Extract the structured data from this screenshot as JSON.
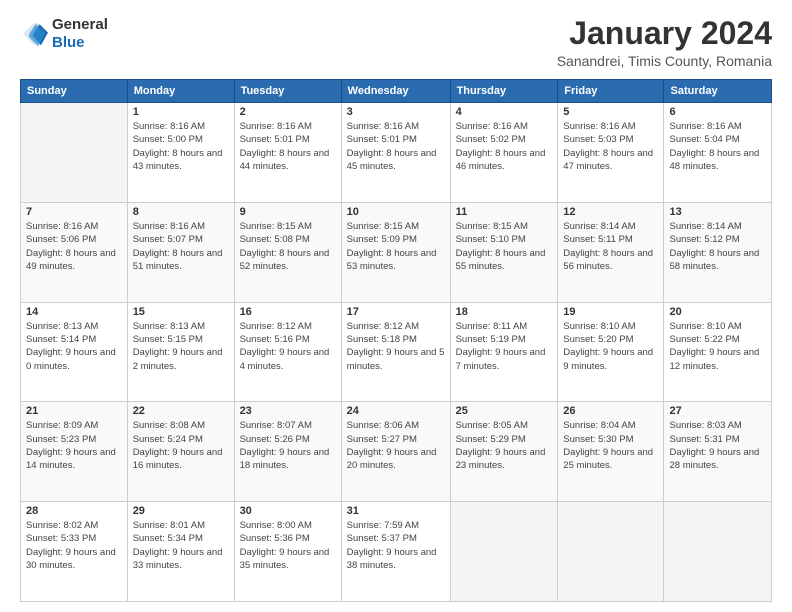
{
  "logo": {
    "general": "General",
    "blue": "Blue"
  },
  "title": {
    "month_year": "January 2024",
    "location": "Sanandrei, Timis County, Romania"
  },
  "weekdays": [
    "Sunday",
    "Monday",
    "Tuesday",
    "Wednesday",
    "Thursday",
    "Friday",
    "Saturday"
  ],
  "weeks": [
    [
      {
        "day": "",
        "sunrise": "",
        "sunset": "",
        "daylight": ""
      },
      {
        "day": "1",
        "sunrise": "Sunrise: 8:16 AM",
        "sunset": "Sunset: 5:00 PM",
        "daylight": "Daylight: 8 hours and 43 minutes."
      },
      {
        "day": "2",
        "sunrise": "Sunrise: 8:16 AM",
        "sunset": "Sunset: 5:01 PM",
        "daylight": "Daylight: 8 hours and 44 minutes."
      },
      {
        "day": "3",
        "sunrise": "Sunrise: 8:16 AM",
        "sunset": "Sunset: 5:01 PM",
        "daylight": "Daylight: 8 hours and 45 minutes."
      },
      {
        "day": "4",
        "sunrise": "Sunrise: 8:16 AM",
        "sunset": "Sunset: 5:02 PM",
        "daylight": "Daylight: 8 hours and 46 minutes."
      },
      {
        "day": "5",
        "sunrise": "Sunrise: 8:16 AM",
        "sunset": "Sunset: 5:03 PM",
        "daylight": "Daylight: 8 hours and 47 minutes."
      },
      {
        "day": "6",
        "sunrise": "Sunrise: 8:16 AM",
        "sunset": "Sunset: 5:04 PM",
        "daylight": "Daylight: 8 hours and 48 minutes."
      }
    ],
    [
      {
        "day": "7",
        "sunrise": "Sunrise: 8:16 AM",
        "sunset": "Sunset: 5:06 PM",
        "daylight": "Daylight: 8 hours and 49 minutes."
      },
      {
        "day": "8",
        "sunrise": "Sunrise: 8:16 AM",
        "sunset": "Sunset: 5:07 PM",
        "daylight": "Daylight: 8 hours and 51 minutes."
      },
      {
        "day": "9",
        "sunrise": "Sunrise: 8:15 AM",
        "sunset": "Sunset: 5:08 PM",
        "daylight": "Daylight: 8 hours and 52 minutes."
      },
      {
        "day": "10",
        "sunrise": "Sunrise: 8:15 AM",
        "sunset": "Sunset: 5:09 PM",
        "daylight": "Daylight: 8 hours and 53 minutes."
      },
      {
        "day": "11",
        "sunrise": "Sunrise: 8:15 AM",
        "sunset": "Sunset: 5:10 PM",
        "daylight": "Daylight: 8 hours and 55 minutes."
      },
      {
        "day": "12",
        "sunrise": "Sunrise: 8:14 AM",
        "sunset": "Sunset: 5:11 PM",
        "daylight": "Daylight: 8 hours and 56 minutes."
      },
      {
        "day": "13",
        "sunrise": "Sunrise: 8:14 AM",
        "sunset": "Sunset: 5:12 PM",
        "daylight": "Daylight: 8 hours and 58 minutes."
      }
    ],
    [
      {
        "day": "14",
        "sunrise": "Sunrise: 8:13 AM",
        "sunset": "Sunset: 5:14 PM",
        "daylight": "Daylight: 9 hours and 0 minutes."
      },
      {
        "day": "15",
        "sunrise": "Sunrise: 8:13 AM",
        "sunset": "Sunset: 5:15 PM",
        "daylight": "Daylight: 9 hours and 2 minutes."
      },
      {
        "day": "16",
        "sunrise": "Sunrise: 8:12 AM",
        "sunset": "Sunset: 5:16 PM",
        "daylight": "Daylight: 9 hours and 4 minutes."
      },
      {
        "day": "17",
        "sunrise": "Sunrise: 8:12 AM",
        "sunset": "Sunset: 5:18 PM",
        "daylight": "Daylight: 9 hours and 5 minutes."
      },
      {
        "day": "18",
        "sunrise": "Sunrise: 8:11 AM",
        "sunset": "Sunset: 5:19 PM",
        "daylight": "Daylight: 9 hours and 7 minutes."
      },
      {
        "day": "19",
        "sunrise": "Sunrise: 8:10 AM",
        "sunset": "Sunset: 5:20 PM",
        "daylight": "Daylight: 9 hours and 9 minutes."
      },
      {
        "day": "20",
        "sunrise": "Sunrise: 8:10 AM",
        "sunset": "Sunset: 5:22 PM",
        "daylight": "Daylight: 9 hours and 12 minutes."
      }
    ],
    [
      {
        "day": "21",
        "sunrise": "Sunrise: 8:09 AM",
        "sunset": "Sunset: 5:23 PM",
        "daylight": "Daylight: 9 hours and 14 minutes."
      },
      {
        "day": "22",
        "sunrise": "Sunrise: 8:08 AM",
        "sunset": "Sunset: 5:24 PM",
        "daylight": "Daylight: 9 hours and 16 minutes."
      },
      {
        "day": "23",
        "sunrise": "Sunrise: 8:07 AM",
        "sunset": "Sunset: 5:26 PM",
        "daylight": "Daylight: 9 hours and 18 minutes."
      },
      {
        "day": "24",
        "sunrise": "Sunrise: 8:06 AM",
        "sunset": "Sunset: 5:27 PM",
        "daylight": "Daylight: 9 hours and 20 minutes."
      },
      {
        "day": "25",
        "sunrise": "Sunrise: 8:05 AM",
        "sunset": "Sunset: 5:29 PM",
        "daylight": "Daylight: 9 hours and 23 minutes."
      },
      {
        "day": "26",
        "sunrise": "Sunrise: 8:04 AM",
        "sunset": "Sunset: 5:30 PM",
        "daylight": "Daylight: 9 hours and 25 minutes."
      },
      {
        "day": "27",
        "sunrise": "Sunrise: 8:03 AM",
        "sunset": "Sunset: 5:31 PM",
        "daylight": "Daylight: 9 hours and 28 minutes."
      }
    ],
    [
      {
        "day": "28",
        "sunrise": "Sunrise: 8:02 AM",
        "sunset": "Sunset: 5:33 PM",
        "daylight": "Daylight: 9 hours and 30 minutes."
      },
      {
        "day": "29",
        "sunrise": "Sunrise: 8:01 AM",
        "sunset": "Sunset: 5:34 PM",
        "daylight": "Daylight: 9 hours and 33 minutes."
      },
      {
        "day": "30",
        "sunrise": "Sunrise: 8:00 AM",
        "sunset": "Sunset: 5:36 PM",
        "daylight": "Daylight: 9 hours and 35 minutes."
      },
      {
        "day": "31",
        "sunrise": "Sunrise: 7:59 AM",
        "sunset": "Sunset: 5:37 PM",
        "daylight": "Daylight: 9 hours and 38 minutes."
      },
      {
        "day": "",
        "sunrise": "",
        "sunset": "",
        "daylight": ""
      },
      {
        "day": "",
        "sunrise": "",
        "sunset": "",
        "daylight": ""
      },
      {
        "day": "",
        "sunrise": "",
        "sunset": "",
        "daylight": ""
      }
    ]
  ]
}
